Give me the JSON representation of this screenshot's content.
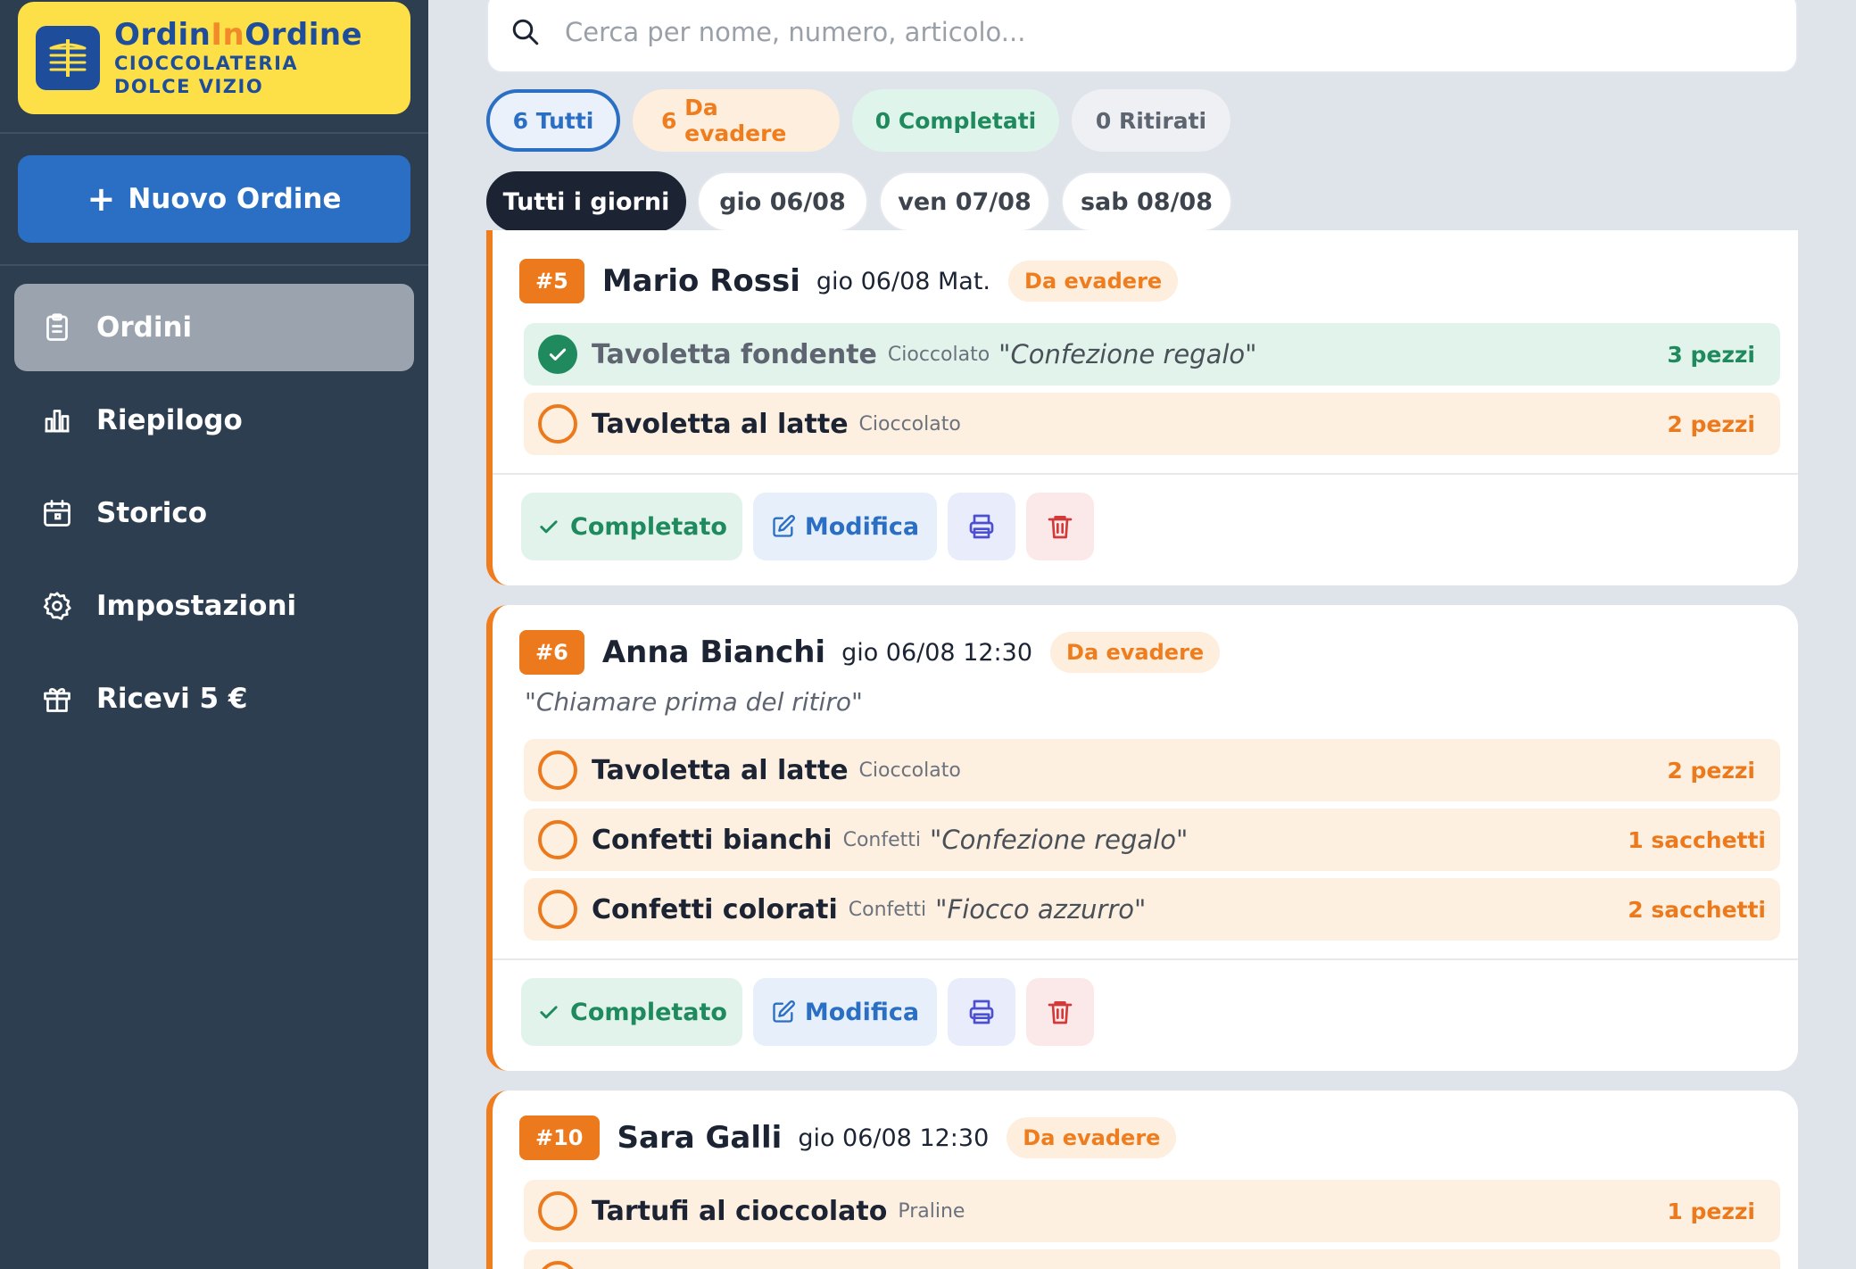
{
  "brand": {
    "name_part1": "Ordin",
    "name_accent": "In",
    "name_part2": "Ordine",
    "subtitle": "CIOCCOLATERIA DOLCE VIZIO"
  },
  "sidebar": {
    "new_order_label": "Nuovo Ordine",
    "items": [
      {
        "label": "Ordini",
        "icon": "clipboard-icon",
        "active": true
      },
      {
        "label": "Riepilogo",
        "icon": "bar-chart-icon",
        "active": false
      },
      {
        "label": "Storico",
        "icon": "calendar-icon",
        "active": false
      },
      {
        "label": "Impostazioni",
        "icon": "gear-icon",
        "active": false
      },
      {
        "label": "Ricevi 5 €",
        "icon": "gift-icon",
        "active": false
      }
    ]
  },
  "search": {
    "placeholder": "Cerca per nome, numero, articolo..."
  },
  "filters": [
    {
      "count": "6",
      "label": "Tutti"
    },
    {
      "count": "6",
      "label": "Da evadere"
    },
    {
      "count": "0",
      "label": "Completati"
    },
    {
      "count": "0",
      "label": "Ritirati"
    }
  ],
  "days": [
    "Tutti i giorni",
    "gio 06/08",
    "ven 07/08",
    "sab 08/08"
  ],
  "actions": {
    "complete_label": "Completato",
    "edit_label": "Modifica"
  },
  "orders": [
    {
      "number": "#5",
      "customer": "Mario Rossi",
      "when": "gio 06/08 Mat.",
      "status": "Da evadere",
      "items": [
        {
          "name": "Tavoletta fondente",
          "category": "Cioccolato",
          "note": "\"Confezione regalo\"",
          "qty": "3 pezzi",
          "done": true
        },
        {
          "name": "Tavoletta al latte",
          "category": "Cioccolato",
          "note": "",
          "qty": "2 pezzi",
          "done": false
        }
      ]
    },
    {
      "number": "#6",
      "customer": "Anna Bianchi",
      "when": "gio 06/08 12:30",
      "status": "Da evadere",
      "note": "\"Chiamare prima del ritiro\"",
      "items": [
        {
          "name": "Tavoletta al latte",
          "category": "Cioccolato",
          "note": "",
          "qty": "2 pezzi",
          "done": false
        },
        {
          "name": "Confetti bianchi",
          "category": "Confetti",
          "note": "\"Confezione regalo\"",
          "qty": "1 sacchetti",
          "done": false
        },
        {
          "name": "Confetti colorati",
          "category": "Confetti",
          "note": "\"Fiocco azzurro\"",
          "qty": "2 sacchetti",
          "done": false
        }
      ]
    },
    {
      "number": "#10",
      "customer": "Sara Galli",
      "when": "gio 06/08 12:30",
      "status": "Da evadere",
      "items": [
        {
          "name": "Tartufi al cioccolato",
          "category": "Praline",
          "note": "",
          "qty": "1 pezzi",
          "done": false
        }
      ]
    }
  ]
}
